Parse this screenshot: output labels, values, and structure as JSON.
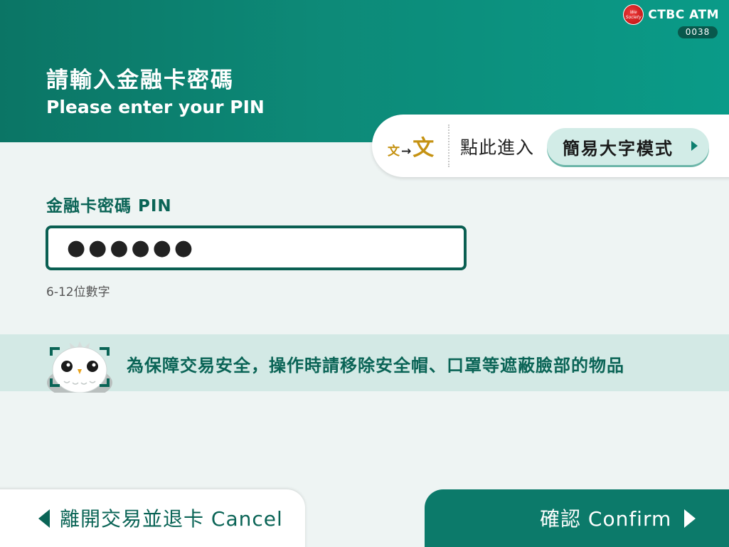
{
  "brand": {
    "name": "CTBC ATM",
    "atm_id": "0038",
    "logo_text": "We Society"
  },
  "header": {
    "title_zh": "請輸入金融卡密碼",
    "title_en": "Please enter your PIN"
  },
  "large_text_mode": {
    "icon_small": "文",
    "icon_arrow": "→",
    "icon_big": "文",
    "hint": "點此進入",
    "button_label": "簡易大字模式"
  },
  "pin": {
    "label": "金融卡密碼 PIN",
    "masked_value": "●●●●●●",
    "hint": "6-12位數字"
  },
  "notice": {
    "text": "為保障交易安全，操作時請移除安全帽、口罩等遮蔽臉部的物品"
  },
  "footer": {
    "cancel_label": "離開交易並退卡 Cancel",
    "confirm_label": "確認 Confirm"
  },
  "colors": {
    "primary": "#0c7a6a",
    "dark": "#0a6456",
    "background": "#eef4f3",
    "notice_bg": "#d3e9e5",
    "accent_gold": "#c59212"
  }
}
